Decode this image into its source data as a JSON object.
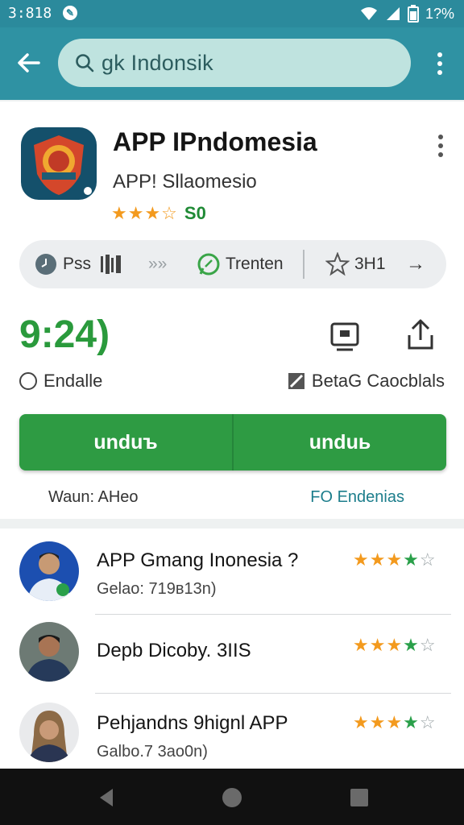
{
  "status": {
    "time": "3:818",
    "battery_text": "1?%"
  },
  "search": {
    "query": "gk Indonsik"
  },
  "app": {
    "title": "APP IPndomesia",
    "developer": "APP! Sllaomesio",
    "rating_stars": "★★★☆",
    "rating_value": "S0",
    "strip": {
      "item1_label": "Pss",
      "item2_label": "Trenten",
      "item3_label": "3H1",
      "arrows_glyph": "»»",
      "next_glyph": "→"
    },
    "big_number": "9:24)",
    "endalle_label": "Endalle",
    "beta_label": "BetaG Caocblals",
    "install_left": "unduъ",
    "install_right": "unduь",
    "footer_left": "Waun: AHeo",
    "footer_right": "FO Endenias"
  },
  "list": {
    "items": [
      {
        "title": "APP Gmang Inonesia ?",
        "subtitle": "Gelao: 719в13n)",
        "rating": 4
      },
      {
        "title": "Depb Dicoby. 3IIS",
        "subtitle": "",
        "rating": 4
      },
      {
        "title": "Pehjandns 9hignl APP",
        "subtitle": "Galbo.7 3ao0n)",
        "rating": 4
      }
    ]
  },
  "colors": {
    "status_bar": "#2b8a9c",
    "app_bar": "#2f92a3",
    "search_pill": "#bfe3df",
    "install_green": "#2e9b43",
    "big_number_green": "#2a9a3c",
    "star_orange": "#f39a1e",
    "star_green": "#2aa04a",
    "teal_link": "#1d7e8c"
  },
  "icons": {
    "status": [
      "notification-icon",
      "wifi-icon",
      "signal-icon",
      "battery-icon"
    ],
    "app_bar": [
      "back-arrow-icon",
      "search-icon",
      "overflow-menu-icon"
    ],
    "strip": [
      "clock-icon",
      "barcode-icon",
      "whatsapp-icon",
      "star-outline-icon",
      "arrow-right-icon"
    ],
    "actions": [
      "monitor-icon",
      "share-icon",
      "edit-icon"
    ],
    "nav": [
      "nav-back-icon",
      "nav-home-icon",
      "nav-recents-icon"
    ]
  }
}
